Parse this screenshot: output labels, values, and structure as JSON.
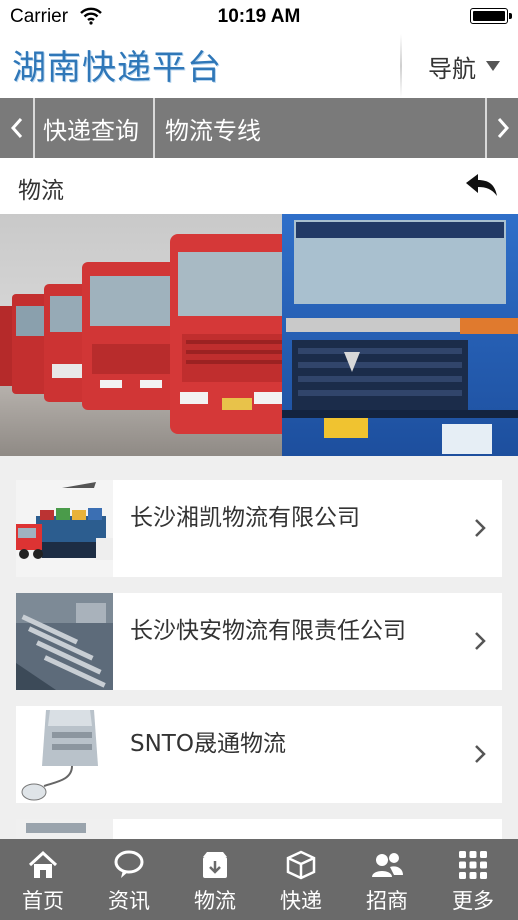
{
  "status_bar": {
    "carrier": "Carrier",
    "time": "10:19 AM"
  },
  "header": {
    "title": "湖南快递平台",
    "nav_label": "导航"
  },
  "tabs": [
    {
      "label": "快递查询"
    },
    {
      "label": "物流专线"
    }
  ],
  "page": {
    "title": "物流"
  },
  "list": [
    {
      "title": "长沙湘凯物流有限公司",
      "thumb_icon": "logistics-truck-ship-image"
    },
    {
      "title": "长沙快安物流有限责任公司",
      "thumb_icon": "port-aerial-image"
    },
    {
      "title": "SNTO晟通物流",
      "thumb_icon": "parcel-mouse-image"
    }
  ],
  "bottom_nav": [
    {
      "label": "首页",
      "icon": "home-icon"
    },
    {
      "label": "资讯",
      "icon": "chat-bubble-icon"
    },
    {
      "label": "物流",
      "icon": "parcel-icon"
    },
    {
      "label": "快递",
      "icon": "box-icon"
    },
    {
      "label": "招商",
      "icon": "people-icon"
    },
    {
      "label": "更多",
      "icon": "grid-icon"
    }
  ],
  "colors": {
    "title_blue": "#2f77b8",
    "tab_bg": "#7a7a7a",
    "bottom_bg": "#6a6a6a",
    "page_bg": "#efefef"
  }
}
